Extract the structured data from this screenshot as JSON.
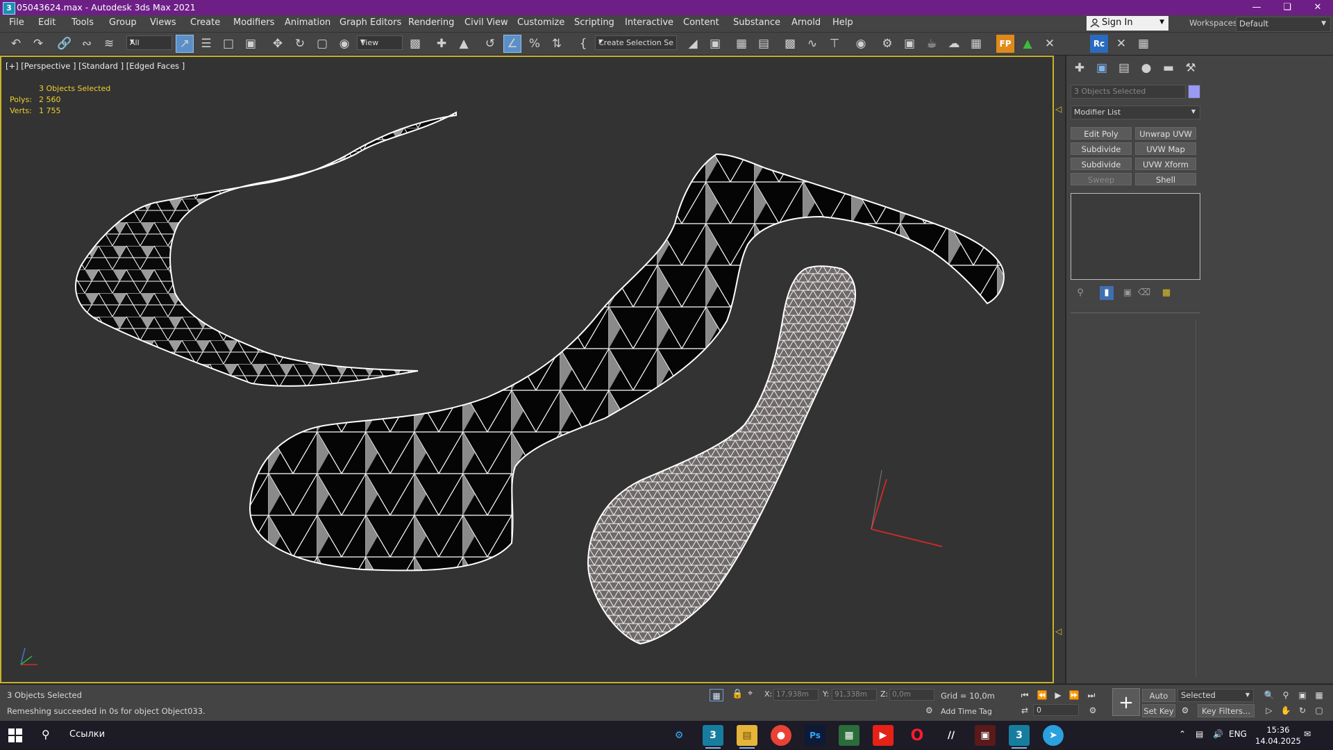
{
  "window": {
    "title": "05043624.max - Autodesk 3ds Max 2021",
    "app_icon": "3"
  },
  "menu": [
    "File",
    "Edit",
    "Tools",
    "Group",
    "Views",
    "Create",
    "Modifiers",
    "Animation",
    "Graph Editors",
    "Rendering",
    "Civil View",
    "Customize",
    "Scripting",
    "Interactive",
    "Content",
    "Substance",
    "Arnold",
    "Help"
  ],
  "account": {
    "sign_in": "Sign In",
    "workspaces_label": "Workspaces:",
    "workspace": "Default"
  },
  "toolbar": {
    "filter": "All",
    "ref_coord": "View",
    "selection_set": "Create Selection Se"
  },
  "viewport": {
    "label": "[+] [Perspective ] [Standard ] [Edged Faces ]",
    "selected": "3 Objects Selected",
    "polys_label": "Polys:",
    "polys": "2 560",
    "verts_label": "Verts:",
    "verts": "1 755"
  },
  "command_panel": {
    "selection_name": "3 Objects Selected",
    "object_color": "#9a99f4",
    "modifier_list": "Modifier List",
    "buttons": [
      "Edit Poly",
      "Unwrap UVW",
      "Subdivide (WSM)",
      "UVW Map",
      "Subdivide",
      "UVW Xform",
      "Sweep",
      "Shell"
    ]
  },
  "status": {
    "line1": "3 Objects Selected",
    "line2": "Remeshing succeeded in 0s for object Object033.",
    "x_label": "X:",
    "x": "17,938m",
    "y_label": "Y:",
    "y": "91,338m",
    "z_label": "Z:",
    "z": "0,0m",
    "grid": "Grid = 10,0m",
    "time_tag": "Add Time Tag",
    "frame": "0",
    "auto_key": "Auto Key",
    "set_key": "Set Key",
    "key_mode": "Selected",
    "key_filters": "Key Filters..."
  },
  "taskbar": {
    "search": "Ссылки",
    "lang": "ENG",
    "time": "15:36",
    "date": "14.04.2025"
  }
}
